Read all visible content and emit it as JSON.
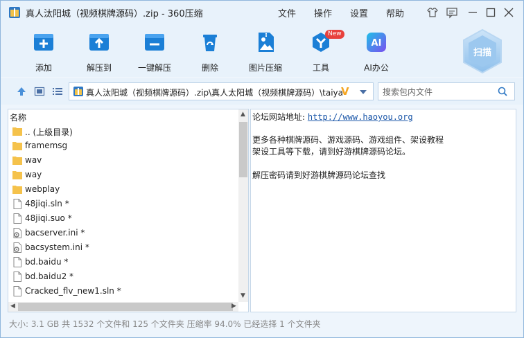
{
  "window": {
    "title": "真人汰阳城（视频棋牌源码）.zip - 360压缩"
  },
  "menu": {
    "file": "文件",
    "operate": "操作",
    "settings": "设置",
    "help": "帮助"
  },
  "toolbar": {
    "add": "添加",
    "extract_to": "解压到",
    "one_click_extract": "一键解压",
    "delete": "删除",
    "image_compress": "图片压缩",
    "tools": "工具",
    "tools_badge": "New",
    "ai_office": "AI办公",
    "ai_icon_text": "AI",
    "scan": "扫描"
  },
  "address": {
    "path": "真人汰阳城（视频棋牌源码）.zip\\真人太阳城（视频棋牌源码）\\taiya",
    "search_placeholder": "搜索包内文件"
  },
  "file_list": {
    "column_name": "名称",
    "items": [
      {
        "name": ".. (上级目录)",
        "type": "folder"
      },
      {
        "name": "framemsg",
        "type": "folder"
      },
      {
        "name": "wav",
        "type": "folder"
      },
      {
        "name": "way",
        "type": "folder"
      },
      {
        "name": "webplay",
        "type": "folder"
      },
      {
        "name": "48jiqi.sln *",
        "type": "file"
      },
      {
        "name": "48jiqi.suo *",
        "type": "file"
      },
      {
        "name": "bacserver.ini *",
        "type": "config"
      },
      {
        "name": "bacsystem.ini *",
        "type": "config"
      },
      {
        "name": "bd.baidu *",
        "type": "file"
      },
      {
        "name": "bd.baidu2 *",
        "type": "file"
      },
      {
        "name": "Cracked_flv_new1.sln *",
        "type": "file"
      }
    ]
  },
  "comment": {
    "site_label": "论坛网站地址:",
    "site_url": "http://www.haoyou.org",
    "line1": "更多各种棋牌源码、游戏源码、游戏组件、架设教程",
    "line2": "架设工具等下载，请到好游棋牌源码论坛。",
    "line3": "解压密码请到好游棋牌源码论坛查找"
  },
  "status": {
    "text": "大小: 3.1 GB 共 1532 个文件和 125 个文件夹 压缩率 94.0% 已经选择 1 个文件夹"
  },
  "colors": {
    "accent": "#1b7fd6",
    "folder": "#f5c24b",
    "link": "#1a56a8",
    "badge": "#e8413c"
  }
}
